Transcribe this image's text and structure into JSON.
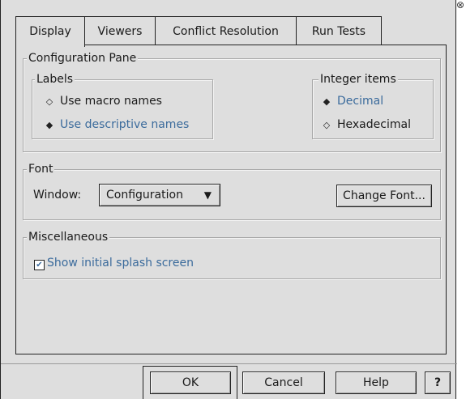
{
  "tabs": [
    {
      "label": "Display",
      "active": true
    },
    {
      "label": "Viewers",
      "active": false
    },
    {
      "label": "Conflict Resolution",
      "active": false
    },
    {
      "label": "Run Tests",
      "active": false
    }
  ],
  "configuration_pane": {
    "title": "Configuration Pane",
    "labels_group": {
      "title": "Labels",
      "options": [
        {
          "label": "Use macro names",
          "selected": false
        },
        {
          "label": "Use descriptive names",
          "selected": true
        }
      ]
    },
    "integer_group": {
      "title": "Integer items",
      "options": [
        {
          "label": "Decimal",
          "selected": true
        },
        {
          "label": "Hexadecimal",
          "selected": false
        }
      ]
    }
  },
  "font_group": {
    "title": "Font",
    "window_label": "Window:",
    "window_value": "Configuration",
    "change_font_label": "Change Font..."
  },
  "misc_group": {
    "title": "Miscellaneous",
    "splash_label": "Show initial splash screen",
    "splash_checked": true
  },
  "buttons": {
    "ok": "OK",
    "cancel": "Cancel",
    "help": "Help",
    "question": "?"
  },
  "glyphs": {
    "radio_on": "◆",
    "radio_off": "◇",
    "check": "✔",
    "dropdown_arrow": "▼",
    "close": "⊗"
  },
  "colors": {
    "selected_text": "#3b6b9c",
    "background": "#dedede"
  }
}
